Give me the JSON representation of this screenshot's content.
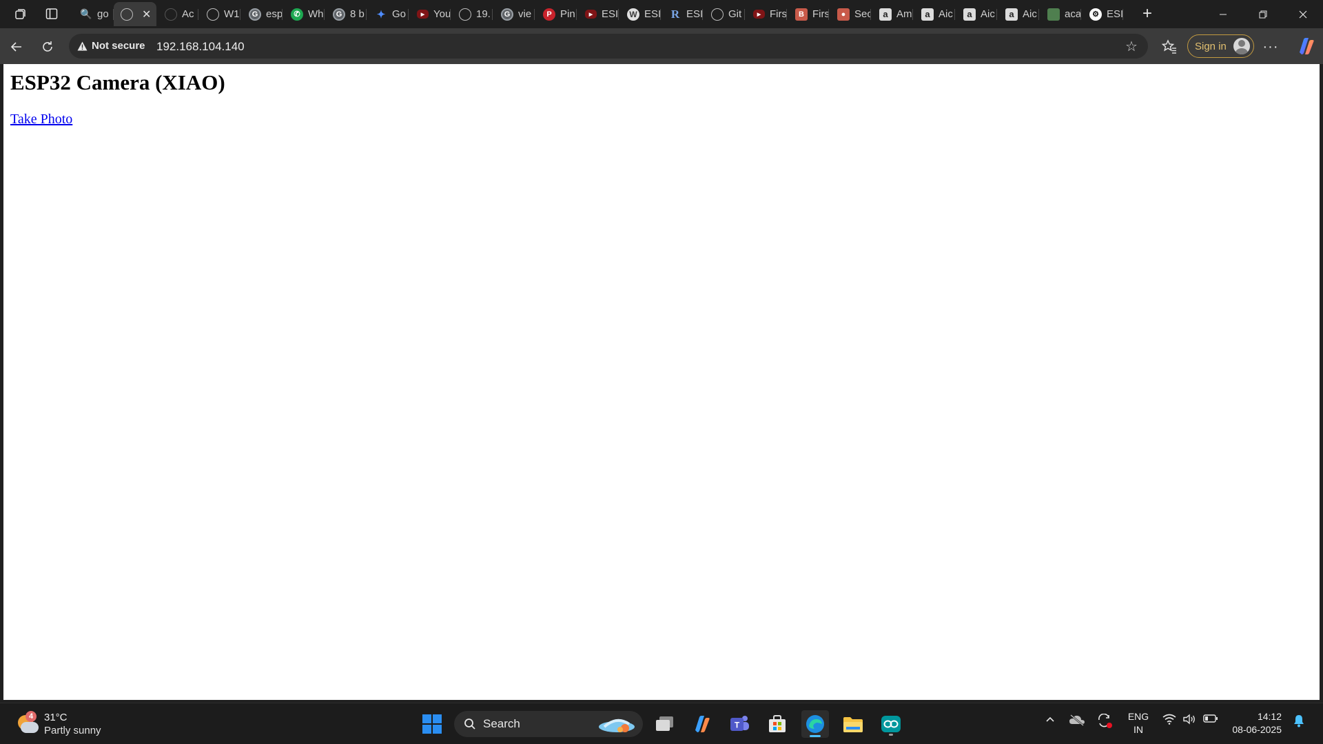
{
  "browser": {
    "tabs": [
      {
        "icon": "search-icon",
        "glyph": "🔍",
        "favicon_class": "search",
        "title": "go"
      },
      {
        "icon": "globe-icon",
        "glyph": "",
        "favicon_class": "globe",
        "title": "",
        "active": true
      },
      {
        "icon": "tab-icon",
        "glyph": "",
        "favicon_class": "dim",
        "title": "Ac"
      },
      {
        "icon": "globe-icon",
        "glyph": "",
        "favicon_class": "globe",
        "title": "W1"
      },
      {
        "icon": "google-icon",
        "glyph": "G",
        "favicon_class": "google",
        "title": "esp"
      },
      {
        "icon": "whatsapp-icon",
        "glyph": "✆",
        "favicon_class": "whatsapp",
        "title": "Wh"
      },
      {
        "icon": "google-icon",
        "glyph": "G",
        "favicon_class": "google",
        "title": "8 b"
      },
      {
        "icon": "gemini-icon",
        "glyph": "✦",
        "favicon_class": "spark",
        "title": "Go"
      },
      {
        "icon": "youtube-icon",
        "glyph": "▶",
        "favicon_class": "yt",
        "title": "You"
      },
      {
        "icon": "globe-icon",
        "glyph": "",
        "favicon_class": "globe",
        "title": "19."
      },
      {
        "icon": "google-icon",
        "glyph": "G",
        "favicon_class": "google",
        "title": "vie"
      },
      {
        "icon": "pinterest-icon",
        "glyph": "P",
        "favicon_class": "pin",
        "title": "Pin"
      },
      {
        "icon": "youtube-icon",
        "glyph": "▶",
        "favicon_class": "yt",
        "title": "ESI"
      },
      {
        "icon": "wordpress-icon",
        "glyph": "W",
        "favicon_class": "wp",
        "title": "ESI"
      },
      {
        "icon": "r-icon",
        "glyph": "R",
        "favicon_class": "r",
        "title": "ESI"
      },
      {
        "icon": "globe-icon",
        "glyph": "",
        "favicon_class": "globe",
        "title": "Git"
      },
      {
        "icon": "youtube-icon",
        "glyph": "▶",
        "favicon_class": "yt",
        "title": "Firs"
      },
      {
        "icon": "blogger-icon",
        "glyph": "B",
        "favicon_class": "blog",
        "title": "Firs"
      },
      {
        "icon": "app-icon",
        "glyph": "●",
        "favicon_class": "blog",
        "title": "Sec"
      },
      {
        "icon": "amazon-icon",
        "glyph": "a",
        "favicon_class": "amz",
        "title": "Am"
      },
      {
        "icon": "amazon-icon",
        "glyph": "a",
        "favicon_class": "amz",
        "title": "Aic"
      },
      {
        "icon": "amazon-icon",
        "glyph": "a",
        "favicon_class": "amz",
        "title": "Aic"
      },
      {
        "icon": "amazon-icon",
        "glyph": "a",
        "favicon_class": "amz",
        "title": "Aic"
      },
      {
        "icon": "image-icon",
        "glyph": "",
        "favicon_class": "img",
        "title": "aca"
      },
      {
        "icon": "openai-icon",
        "glyph": "⚙",
        "favicon_class": "openai",
        "title": "ESI"
      }
    ],
    "security_label": "Not secure",
    "url": "192.168.104.140",
    "signin_label": "Sign in"
  },
  "page": {
    "heading": "ESP32 Camera (XIAO)",
    "link_text": "Take Photo"
  },
  "taskbar": {
    "weather_badge": "4",
    "temperature": "31°C",
    "condition": "Partly sunny",
    "search_label": "Search",
    "language": "ENG",
    "region": "IN",
    "time": "14:12",
    "date": "08-06-2025"
  },
  "colors": {
    "accent_blue": "#2a8ef2",
    "link": "#0000ee",
    "signin_border": "#c39b41"
  }
}
